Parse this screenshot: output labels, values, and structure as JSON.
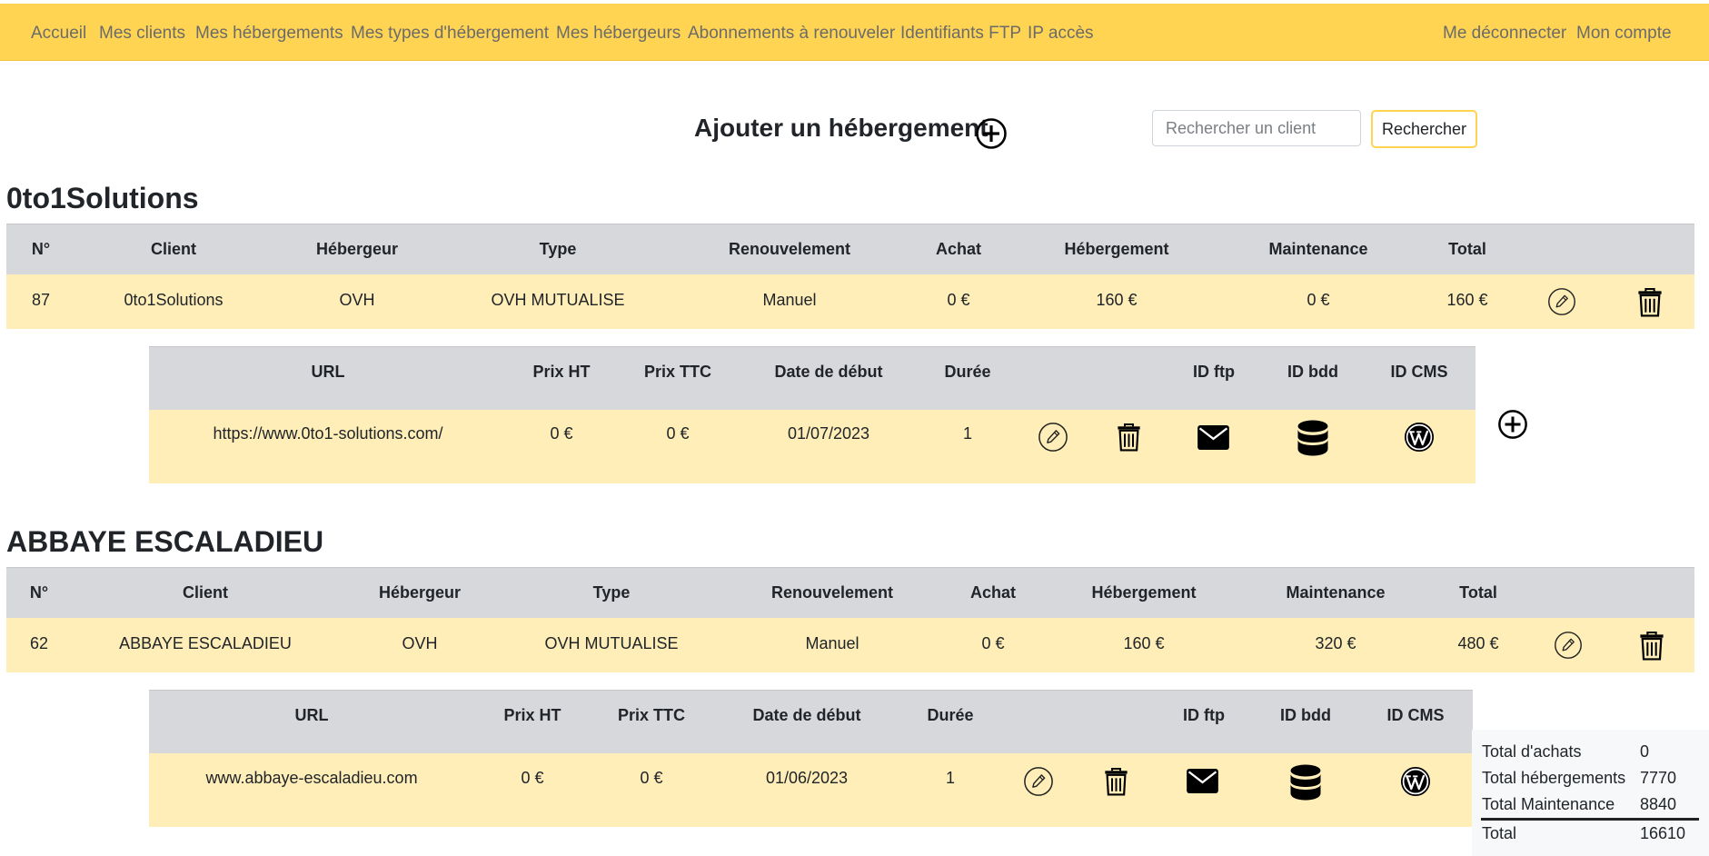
{
  "nav": {
    "left": [
      "Accueil",
      "Mes clients",
      "Mes hébergements",
      "Mes types d'hébergement",
      "Mes hébergeurs",
      "Abonnements à renouveler",
      "Identifiants FTP",
      "IP accès"
    ],
    "logout": "Me déconnecter",
    "account": "Mon compte"
  },
  "header": {
    "add_title": "Ajouter un hébergement",
    "search_placeholder": "Rechercher un client",
    "search_button": "Rechercher"
  },
  "main_columns": [
    "N°",
    "Client",
    "Hébergeur",
    "Type",
    "Renouvelement",
    "Achat",
    "Hébergement",
    "Maintenance",
    "Total"
  ],
  "site_columns": [
    "URL",
    "Prix HT",
    "Prix TTC",
    "Date de début",
    "Durée",
    "ID ftp",
    "ID bdd",
    "ID CMS"
  ],
  "clients": [
    {
      "name": "0to1Solutions",
      "row": [
        "87",
        "0to1Solutions",
        "OVH",
        "OVH MUTUALISE",
        "Manuel",
        "0 €",
        "160 €",
        "0 €",
        "160 €"
      ],
      "site": [
        "https://www.0to1-solutions.com/",
        "0 €",
        "0 €",
        "01/07/2023",
        "1"
      ]
    },
    {
      "name": "ABBAYE ESCALADIEU",
      "row": [
        "62",
        "ABBAYE ESCALADIEU",
        "OVH",
        "OVH MUTUALISE",
        "Manuel",
        "0 €",
        "160 €",
        "320 €",
        "480 €"
      ],
      "site": [
        "www.abbaye-escaladieu.com",
        "0 €",
        "0 €",
        "01/06/2023",
        "1"
      ]
    }
  ],
  "totals": {
    "achats_label": "Total d'achats",
    "achats": "0",
    "hebergements_label": "Total hébergements",
    "hebergements": "7770",
    "maintenance_label": "Total Maintenance",
    "maintenance": "8840",
    "total_label": "Total",
    "total": "16610"
  },
  "colors": {
    "navbar": "#ffd452",
    "row": "#ffeeb8",
    "header": "#d7d8dc"
  },
  "icons": [
    "plus-circle-icon",
    "pencil-circle-icon",
    "trash-icon",
    "envelope-icon",
    "database-icon",
    "wordpress-icon"
  ]
}
